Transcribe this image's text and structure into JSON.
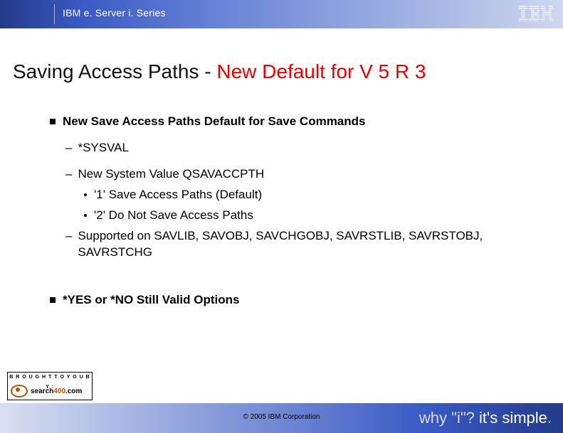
{
  "header": {
    "brand": "IBM e. Server i. Series"
  },
  "title": {
    "part1": "Saving Access Paths - ",
    "part2_red": "New Default for V 5 R 3"
  },
  "bullets": {
    "b1": "New Save Access Paths Default for Save Commands",
    "b1_d1": "*SYSVAL",
    "b1_d2": "New System Value QSAVACCPTH",
    "b1_d2_s1": "'1' Save Access Paths (Default)",
    "b1_d2_s2": "'2' Do Not Save Access Paths",
    "b1_d3": "Supported on SAVLIB, SAVOBJ, SAVCHGOBJ,  SAVRSTLIB, SAVRSTOBJ, SAVRSTCHG",
    "b2": "*YES or *NO Still Valid Options"
  },
  "footer": {
    "copyright": "© 2005 IBM Corporation",
    "tag_why": "why \"i\"?",
    "tag_simple": "  it's simple."
  },
  "badge": {
    "top": "B R O U G H T  T O  Y O U  B Y :",
    "name_part1": "search",
    "name_part2": "400",
    "name_part3": ".com"
  }
}
